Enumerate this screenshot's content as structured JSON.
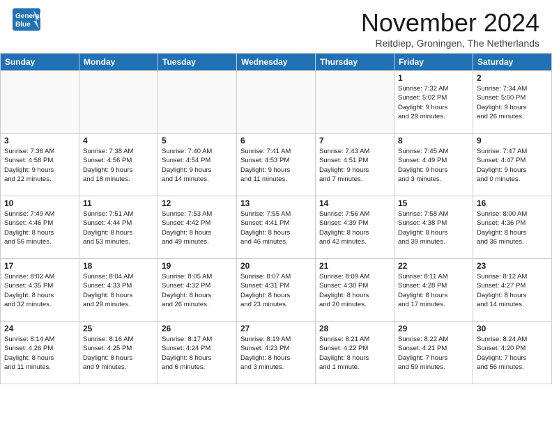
{
  "header": {
    "logo_general": "General",
    "logo_blue": "Blue",
    "month": "November 2024",
    "location": "Reitdiep, Groningen, The Netherlands"
  },
  "weekdays": [
    "Sunday",
    "Monday",
    "Tuesday",
    "Wednesday",
    "Thursday",
    "Friday",
    "Saturday"
  ],
  "weeks": [
    [
      {
        "day": "",
        "info": ""
      },
      {
        "day": "",
        "info": ""
      },
      {
        "day": "",
        "info": ""
      },
      {
        "day": "",
        "info": ""
      },
      {
        "day": "",
        "info": ""
      },
      {
        "day": "1",
        "info": "Sunrise: 7:32 AM\nSunset: 5:02 PM\nDaylight: 9 hours\nand 29 minutes."
      },
      {
        "day": "2",
        "info": "Sunrise: 7:34 AM\nSunset: 5:00 PM\nDaylight: 9 hours\nand 26 minutes."
      }
    ],
    [
      {
        "day": "3",
        "info": "Sunrise: 7:36 AM\nSunset: 4:58 PM\nDaylight: 9 hours\nand 22 minutes."
      },
      {
        "day": "4",
        "info": "Sunrise: 7:38 AM\nSunset: 4:56 PM\nDaylight: 9 hours\nand 18 minutes."
      },
      {
        "day": "5",
        "info": "Sunrise: 7:40 AM\nSunset: 4:54 PM\nDaylight: 9 hours\nand 14 minutes."
      },
      {
        "day": "6",
        "info": "Sunrise: 7:41 AM\nSunset: 4:53 PM\nDaylight: 9 hours\nand 11 minutes."
      },
      {
        "day": "7",
        "info": "Sunrise: 7:43 AM\nSunset: 4:51 PM\nDaylight: 9 hours\nand 7 minutes."
      },
      {
        "day": "8",
        "info": "Sunrise: 7:45 AM\nSunset: 4:49 PM\nDaylight: 9 hours\nand 3 minutes."
      },
      {
        "day": "9",
        "info": "Sunrise: 7:47 AM\nSunset: 4:47 PM\nDaylight: 9 hours\nand 0 minutes."
      }
    ],
    [
      {
        "day": "10",
        "info": "Sunrise: 7:49 AM\nSunset: 4:46 PM\nDaylight: 8 hours\nand 56 minutes."
      },
      {
        "day": "11",
        "info": "Sunrise: 7:51 AM\nSunset: 4:44 PM\nDaylight: 8 hours\nand 53 minutes."
      },
      {
        "day": "12",
        "info": "Sunrise: 7:53 AM\nSunset: 4:42 PM\nDaylight: 8 hours\nand 49 minutes."
      },
      {
        "day": "13",
        "info": "Sunrise: 7:55 AM\nSunset: 4:41 PM\nDaylight: 8 hours\nand 46 minutes."
      },
      {
        "day": "14",
        "info": "Sunrise: 7:56 AM\nSunset: 4:39 PM\nDaylight: 8 hours\nand 42 minutes."
      },
      {
        "day": "15",
        "info": "Sunrise: 7:58 AM\nSunset: 4:38 PM\nDaylight: 8 hours\nand 39 minutes."
      },
      {
        "day": "16",
        "info": "Sunrise: 8:00 AM\nSunset: 4:36 PM\nDaylight: 8 hours\nand 36 minutes."
      }
    ],
    [
      {
        "day": "17",
        "info": "Sunrise: 8:02 AM\nSunset: 4:35 PM\nDaylight: 8 hours\nand 32 minutes."
      },
      {
        "day": "18",
        "info": "Sunrise: 8:04 AM\nSunset: 4:33 PM\nDaylight: 8 hours\nand 29 minutes."
      },
      {
        "day": "19",
        "info": "Sunrise: 8:05 AM\nSunset: 4:32 PM\nDaylight: 8 hours\nand 26 minutes."
      },
      {
        "day": "20",
        "info": "Sunrise: 8:07 AM\nSunset: 4:31 PM\nDaylight: 8 hours\nand 23 minutes."
      },
      {
        "day": "21",
        "info": "Sunrise: 8:09 AM\nSunset: 4:30 PM\nDaylight: 8 hours\nand 20 minutes."
      },
      {
        "day": "22",
        "info": "Sunrise: 8:11 AM\nSunset: 4:28 PM\nDaylight: 8 hours\nand 17 minutes."
      },
      {
        "day": "23",
        "info": "Sunrise: 8:12 AM\nSunset: 4:27 PM\nDaylight: 8 hours\nand 14 minutes."
      }
    ],
    [
      {
        "day": "24",
        "info": "Sunrise: 8:14 AM\nSunset: 4:26 PM\nDaylight: 8 hours\nand 11 minutes."
      },
      {
        "day": "25",
        "info": "Sunrise: 8:16 AM\nSunset: 4:25 PM\nDaylight: 8 hours\nand 9 minutes."
      },
      {
        "day": "26",
        "info": "Sunrise: 8:17 AM\nSunset: 4:24 PM\nDaylight: 8 hours\nand 6 minutes."
      },
      {
        "day": "27",
        "info": "Sunrise: 8:19 AM\nSunset: 4:23 PM\nDaylight: 8 hours\nand 3 minutes."
      },
      {
        "day": "28",
        "info": "Sunrise: 8:21 AM\nSunset: 4:22 PM\nDaylight: 8 hours\nand 1 minute."
      },
      {
        "day": "29",
        "info": "Sunrise: 8:22 AM\nSunset: 4:21 PM\nDaylight: 7 hours\nand 59 minutes."
      },
      {
        "day": "30",
        "info": "Sunrise: 8:24 AM\nSunset: 4:20 PM\nDaylight: 7 hours\nand 56 minutes."
      }
    ]
  ]
}
